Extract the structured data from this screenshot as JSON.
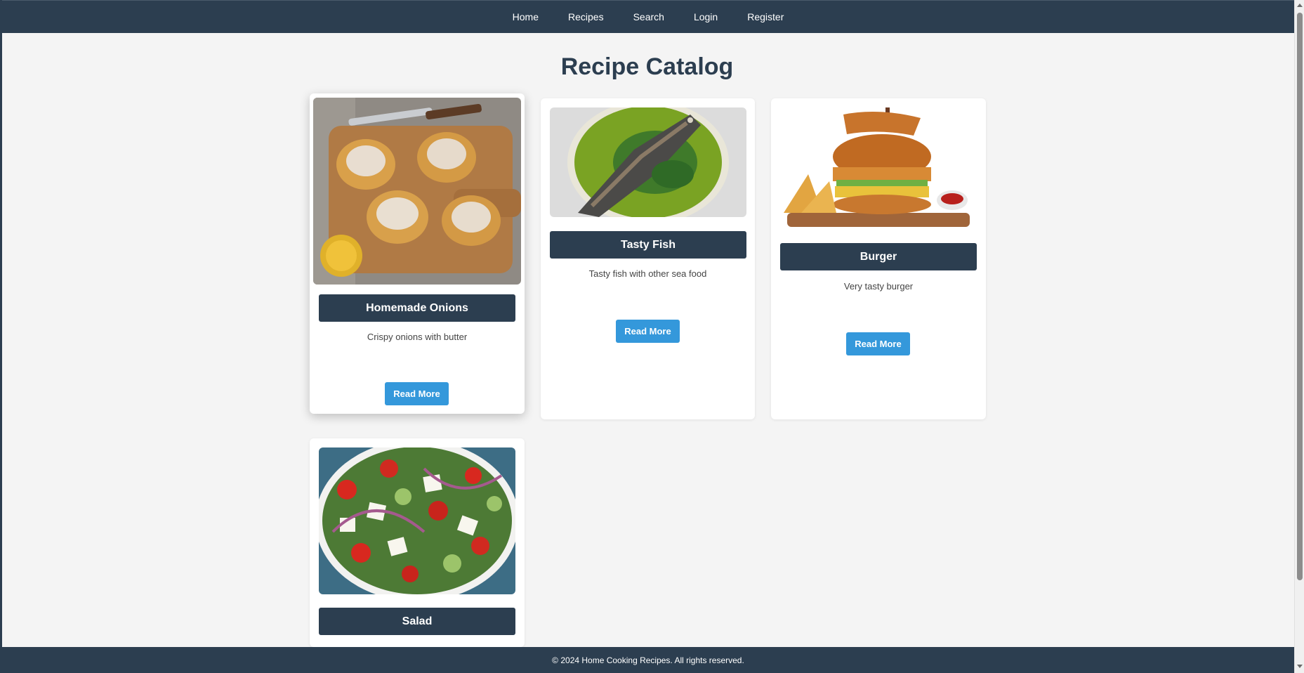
{
  "nav": {
    "items": [
      {
        "label": "Home"
      },
      {
        "label": "Recipes"
      },
      {
        "label": "Search"
      },
      {
        "label": "Login"
      },
      {
        "label": "Register"
      }
    ]
  },
  "page": {
    "title": "Recipe Catalog"
  },
  "recipes": [
    {
      "title": "Homemade Onions",
      "description": "Crispy onions with butter",
      "button": "Read More",
      "image": "stuffed-potatoes-photo"
    },
    {
      "title": "Tasty Fish",
      "description": "Tasty fish with other sea food",
      "button": "Read More",
      "image": "grilled-fish-photo"
    },
    {
      "title": "Burger",
      "description": "Very tasty burger",
      "button": "Read More",
      "image": "chicken-burger-photo"
    },
    {
      "title": "Salad",
      "description": "",
      "button": "",
      "image": "greek-salad-photo"
    }
  ],
  "footer": {
    "text": "© 2024 Home Cooking Recipes. All rights reserved."
  },
  "colors": {
    "header": "#2c3e50",
    "accent": "#3498db",
    "background": "#f4f4f4"
  }
}
